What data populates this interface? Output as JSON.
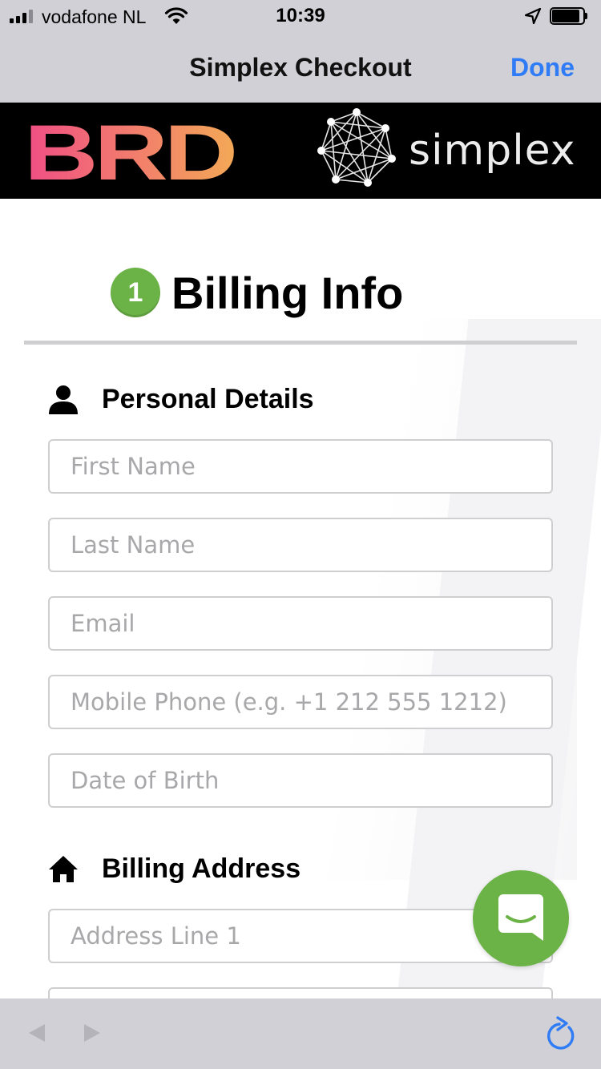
{
  "status_bar": {
    "carrier": "vodafone NL",
    "time": "10:39",
    "icons": [
      "signal-icon",
      "wifi-icon",
      "location-arrow-icon",
      "battery-icon"
    ]
  },
  "nav_bar": {
    "title": "Simplex Checkout",
    "done_label": "Done"
  },
  "banner": {
    "brd_logo": "BRD",
    "simplex_logo": "simplex"
  },
  "step": {
    "number": "1",
    "title": "Billing Info"
  },
  "personal_details": {
    "heading": "Personal Details",
    "icon": "person-icon",
    "fields": {
      "first_name": {
        "placeholder": "First Name",
        "value": ""
      },
      "last_name": {
        "placeholder": "Last Name",
        "value": ""
      },
      "email": {
        "placeholder": "Email",
        "value": ""
      },
      "mobile_phone": {
        "placeholder": "Mobile Phone (e.g. +1 212 555 1212)",
        "value": ""
      },
      "date_of_birth": {
        "placeholder": "Date of Birth",
        "value": ""
      }
    }
  },
  "billing_address": {
    "heading": "Billing Address",
    "icon": "home-icon",
    "fields": {
      "address_line_1": {
        "placeholder": "Address Line 1",
        "value": ""
      },
      "address_line_2": {
        "placeholder": "",
        "value": ""
      }
    }
  },
  "chat": {
    "icon": "chat-bubble-icon"
  },
  "toolbar": {
    "icons": [
      "back-arrow-icon",
      "forward-arrow-icon",
      "reload-icon"
    ]
  },
  "colors": {
    "accent_green": "#6bb347",
    "ios_blue": "#2f7cf6",
    "chrome_gray": "#d1d0d6",
    "brd_gradient_start": "#f04e84",
    "brd_gradient_end": "#f3a857"
  }
}
